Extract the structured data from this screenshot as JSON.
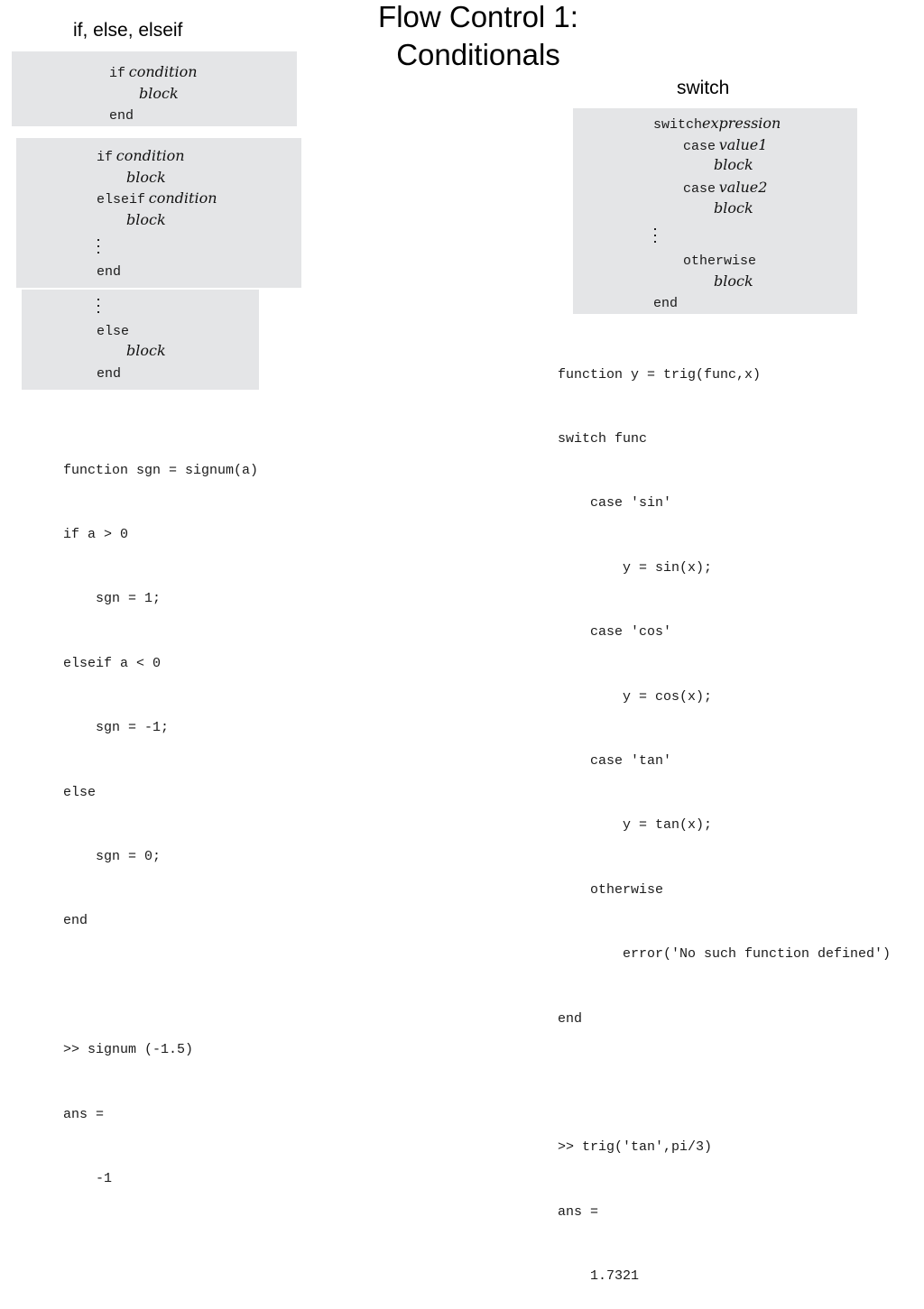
{
  "slide": {
    "title_line1": "Flow Control 1:",
    "title_line2": "Conditionals",
    "left_heading": "if, else, elseif",
    "right_heading": "switch"
  },
  "if_box": {
    "keyword_if": "if",
    "condition": "condition",
    "block": "block",
    "keyword_end": "end"
  },
  "elseif_box": {
    "keyword_if": "if",
    "condition1": "condition",
    "block1": "block",
    "keyword_elseif": "elseif",
    "condition2": "condition",
    "block2": "block",
    "keyword_end": "end"
  },
  "else_box": {
    "keyword_else": "else",
    "block": "block",
    "keyword_end": "end"
  },
  "switch_box": {
    "keyword_switch": "switch",
    "expression": "expression",
    "keyword_case1": "case",
    "value1": "value1",
    "block1": "block",
    "keyword_case2": "case",
    "value2": "value2",
    "block2": "block",
    "keyword_otherwise": "otherwise",
    "block3": "block",
    "keyword_end": "end"
  },
  "signum_code": {
    "lines": [
      "function sgn = signum(a)",
      "if a > 0",
      "    sgn = 1;",
      "elseif a < 0",
      "    sgn = -1;",
      "else",
      "    sgn = 0;",
      "end",
      "",
      ">> signum (-1.5)",
      "ans =",
      "    -1"
    ]
  },
  "trig_code": {
    "lines": [
      "function y = trig(func,x)",
      "switch func",
      "    case 'sin'",
      "        y = sin(x);",
      "    case 'cos'",
      "        y = cos(x);",
      "    case 'tan'",
      "        y = tan(x);",
      "    otherwise",
      "        error('No such function defined')",
      "end",
      "",
      ">> trig('tan',pi/3)",
      "ans =",
      "    1.7321"
    ]
  }
}
